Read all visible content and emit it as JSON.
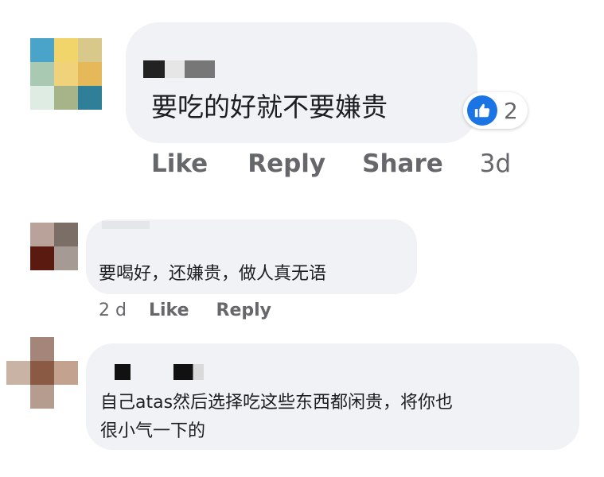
{
  "comments": [
    {
      "text": "要吃的好就不要嫌贵",
      "reaction_count": "2",
      "actions": {
        "like": "Like",
        "reply": "Reply",
        "share": "Share",
        "time": "3d"
      }
    },
    {
      "text": "要喝好，还嫌贵，做人真无语",
      "actions": {
        "time": "2 d",
        "like": "Like",
        "reply": "Reply"
      }
    },
    {
      "text_line1": "自己atas然后选择吃这些东西都闲贵，将你也",
      "text_line2": "很小气一下的"
    }
  ],
  "colors": {
    "bubble": "#f0f2f5",
    "meta_text": "#65676b",
    "like_blue": "#1b74e4"
  },
  "icons": {
    "reaction": "thumbs-up-icon"
  }
}
